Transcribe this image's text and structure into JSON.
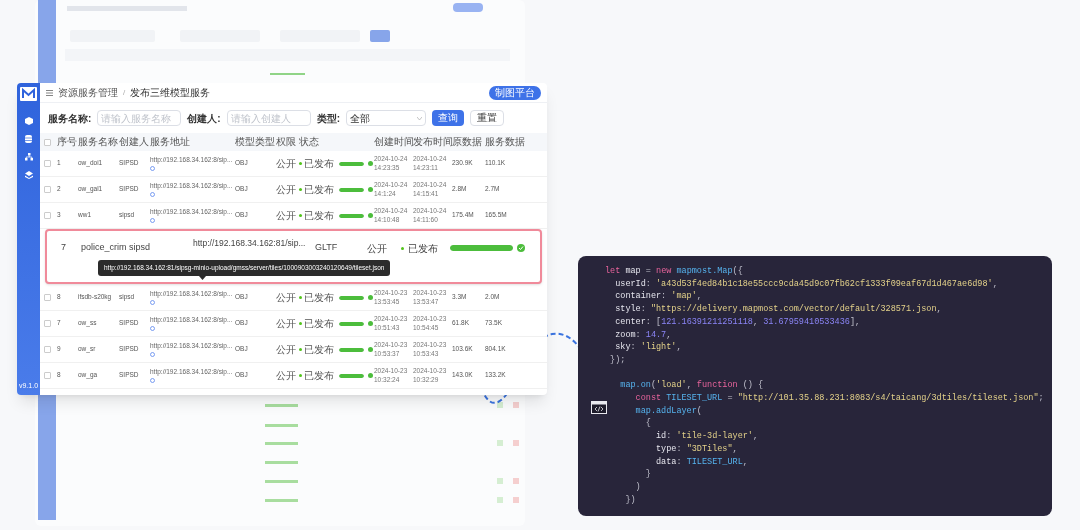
{
  "main_window": {
    "breadcrumb": {
      "parent": "资源服务管理",
      "separator": "/",
      "current": "发布三维模型服务"
    },
    "header_button": "制图平台",
    "version": "v9.1.0",
    "filters": [
      {
        "kind": "input",
        "label": "服务名称:",
        "placeholder": "请输入服务名称"
      },
      {
        "kind": "input",
        "label": "创建人:",
        "placeholder": "请输入创建人"
      },
      {
        "kind": "select",
        "label": "类型:",
        "value": "全部"
      }
    ],
    "buttons": [
      {
        "kind": "primary",
        "label": "查询"
      },
      {
        "kind": "default",
        "label": "重置"
      }
    ],
    "table": {
      "header_checked": false,
      "columns": [
        "序号",
        "服务名称",
        "创建人",
        "服务地址",
        "模型类型",
        "权限",
        "状态",
        "创建时间",
        "发布时间",
        "原数据",
        "服务数据"
      ],
      "rows_above": [
        {
          "checked": false,
          "number": "1",
          "name": "ow_doi1",
          "creator": "SIPSD",
          "url": "http://192.168.34.162:8/sip...",
          "type": "OBJ",
          "permission": "公开",
          "status": "已发布",
          "level": 1,
          "created": "2024-10-24 14:23:35",
          "published": "2024-10-24 14:23:11",
          "source_size": "230.9K",
          "service_size": "110.1K"
        },
        {
          "checked": false,
          "number": "2",
          "name": "ow_gal1",
          "creator": "SIPSD",
          "url": "http://192.168.34.162:8/sip...",
          "type": "OBJ",
          "permission": "公开",
          "status": "已发布",
          "level": 1,
          "created": "2024-10-24 14:1:24",
          "published": "2024-10-24 14:15:41",
          "source_size": "2.8M",
          "service_size": "2.7M"
        },
        {
          "checked": false,
          "number": "3",
          "name": "ww1",
          "creator": "sipsd",
          "url": "http://192.168.34.162:8/sip...",
          "type": "OBJ",
          "permission": "公开",
          "status": "已发布",
          "level": 1,
          "created": "2024-10-24 14:10:48",
          "published": "2024-10-24 14:11:60",
          "source_size": "175.4M",
          "service_size": "165.5M"
        }
      ],
      "rows_below": [
        {
          "checked": false,
          "number": "8",
          "name": "ifsdb-s20kg",
          "creator": "sipsd",
          "url": "http://192.168.34.162:8/sip...",
          "type": "OBJ",
          "permission": "公开",
          "status": "已发布",
          "level": 1,
          "created": "2024-10-23 13:53:45",
          "published": "2024-10-23 13:53:47",
          "source_size": "3.3M",
          "service_size": "2.0M"
        },
        {
          "checked": false,
          "number": "7",
          "name": "ow_ss",
          "creator": "SIPSD",
          "url": "http://192.168.34.162:8/sip...",
          "type": "OBJ",
          "permission": "公开",
          "status": "已发布",
          "level": 1,
          "created": "2024-10-23 10:51:43",
          "published": "2024-10-23 10:54:45",
          "source_size": "61.8K",
          "service_size": "73.5K"
        },
        {
          "checked": false,
          "number": "9",
          "name": "ow_sr",
          "creator": "SIPSD",
          "url": "http://192.168.34.162:8/sip...",
          "type": "OBJ",
          "permission": "公开",
          "status": "已发布",
          "level": 1,
          "created": "2024-10-23 10:53:37",
          "published": "2024-10-23 10:53:43",
          "source_size": "103.6K",
          "service_size": "804.1K"
        },
        {
          "checked": false,
          "number": "8",
          "name": "ow_ga",
          "creator": "SIPSD",
          "url": "http://192.168.34.162:8/sip...",
          "type": "OBJ",
          "permission": "公开",
          "status": "已发布",
          "level": 1,
          "created": "2024-10-23 10:32:24",
          "published": "2024-10-23 10:32:29",
          "source_size": "143.0K",
          "service_size": "133.2K"
        }
      ]
    }
  },
  "highlighted_row": {
    "number": "7",
    "name": "police_crim",
    "creator": "sipsd",
    "url": "http://192.168.34.162:81/sip...",
    "type": "GLTF",
    "permission": "公开",
    "status": "已发布",
    "level": 1,
    "tooltip": "http://192.168.34.162:81/sipsg-minio-upload/gmss/server/tiles/1000903003240120649/tileset.json"
  },
  "code_panel": {
    "lines": [
      {
        "tokens": [
          {
            "kind": "kw",
            "text": "let"
          },
          {
            "kind": "prop",
            "text": " map "
          },
          {
            "kind": "punct",
            "text": "= "
          },
          {
            "kind": "kw",
            "text": "new "
          },
          {
            "kind": "id",
            "text": "mapmost.Map"
          },
          {
            "kind": "punct",
            "text": "({"
          }
        ]
      },
      {
        "tokens": [
          {
            "kind": "prop",
            "text": "  userId"
          },
          {
            "kind": "punct",
            "text": ": "
          },
          {
            "kind": "str",
            "text": "'a43d53f4ed84b1c18e55ccc9cda45d9c07fb62cf1333f09eaf67d1d467ae6d98'"
          },
          {
            "kind": "punct",
            "text": ","
          }
        ]
      },
      {
        "tokens": [
          {
            "kind": "prop",
            "text": "  container"
          },
          {
            "kind": "punct",
            "text": ": "
          },
          {
            "kind": "str",
            "text": "'map'"
          },
          {
            "kind": "punct",
            "text": ","
          }
        ]
      },
      {
        "tokens": [
          {
            "kind": "prop",
            "text": "  style"
          },
          {
            "kind": "punct",
            "text": ": "
          },
          {
            "kind": "str",
            "text": "\"https://delivery.mapmost.com/vector/default/328571.json"
          },
          {
            "kind": "punct",
            "text": ","
          }
        ]
      },
      {
        "tokens": [
          {
            "kind": "prop",
            "text": "  center"
          },
          {
            "kind": "punct",
            "text": ": ["
          },
          {
            "kind": "num",
            "text": "121.16391211251118"
          },
          {
            "kind": "punct",
            "text": ", "
          },
          {
            "kind": "num",
            "text": "31.67959410533436"
          },
          {
            "kind": "punct",
            "text": "],"
          }
        ]
      },
      {
        "tokens": [
          {
            "kind": "prop",
            "text": "  zoom"
          },
          {
            "kind": "punct",
            "text": ": "
          },
          {
            "kind": "num",
            "text": "14.7"
          },
          {
            "kind": "punct",
            "text": ","
          }
        ]
      },
      {
        "tokens": [
          {
            "kind": "prop",
            "text": "  sky"
          },
          {
            "kind": "punct",
            "text": ": "
          },
          {
            "kind": "str",
            "text": "'light'"
          },
          {
            "kind": "punct",
            "text": ","
          }
        ]
      },
      {
        "tokens": [
          {
            "kind": "punct",
            "text": " });"
          }
        ]
      },
      {
        "gap_before": true,
        "tokens": [
          {
            "kind": "id",
            "text": "   map.on"
          },
          {
            "kind": "punct",
            "text": "("
          },
          {
            "kind": "str",
            "text": "'load'"
          },
          {
            "kind": "punct",
            "text": ", "
          },
          {
            "kind": "kw",
            "text": "function"
          },
          {
            "kind": "punct",
            "text": " () {"
          }
        ]
      },
      {
        "tokens": [
          {
            "kind": "kw",
            "text": "      const"
          },
          {
            "kind": "id",
            "text": " TILESET_URL "
          },
          {
            "kind": "punct",
            "text": "= "
          },
          {
            "kind": "str",
            "text": "\"http://101.35.88.231:8083/s4/taicang/3dtiles/tileset.json\""
          },
          {
            "kind": "punct",
            "text": ";"
          }
        ]
      },
      {
        "tokens": [
          {
            "kind": "id",
            "text": "      map.addLayer"
          },
          {
            "kind": "punct",
            "text": "("
          }
        ]
      },
      {
        "tokens": [
          {
            "kind": "punct",
            "text": "        {"
          }
        ]
      },
      {
        "tokens": [
          {
            "kind": "prop",
            "text": "          id"
          },
          {
            "kind": "punct",
            "text": ": "
          },
          {
            "kind": "str",
            "text": "'tile-3d-layer'"
          },
          {
            "kind": "punct",
            "text": ","
          }
        ]
      },
      {
        "tokens": [
          {
            "kind": "prop",
            "text": "          type"
          },
          {
            "kind": "punct",
            "text": ": "
          },
          {
            "kind": "str",
            "text": "\"3DTiles\""
          },
          {
            "kind": "punct",
            "text": ","
          }
        ]
      },
      {
        "tokens": [
          {
            "kind": "prop",
            "text": "          data"
          },
          {
            "kind": "punct",
            "text": ": "
          },
          {
            "kind": "id",
            "text": "TILESET_URL"
          },
          {
            "kind": "punct",
            "text": ","
          }
        ]
      },
      {
        "tokens": [
          {
            "kind": "punct",
            "text": "        }"
          }
        ]
      },
      {
        "tokens": [
          {
            "kind": "punct",
            "text": "      )"
          }
        ]
      },
      {
        "tokens": [
          {
            "kind": "punct",
            "text": "    })"
          }
        ]
      }
    ]
  }
}
